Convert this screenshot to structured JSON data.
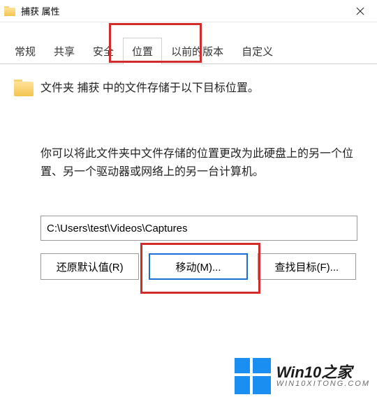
{
  "window": {
    "title": "捕获 属性"
  },
  "tabs": {
    "items": [
      {
        "label": "常规"
      },
      {
        "label": "共享"
      },
      {
        "label": "安全"
      },
      {
        "label": "位置"
      },
      {
        "label": "以前的版本"
      },
      {
        "label": "自定义"
      }
    ],
    "active_index": 3
  },
  "content": {
    "line1": "文件夹 捕获 中的文件存储于以下目标位置。",
    "line2": "你可以将此文件夹中文件存储的位置更改为此硬盘上的另一个位置、另一个驱动器或网络上的另一台计算机。",
    "path": "C:\\Users\\test\\Videos\\Captures"
  },
  "buttons": {
    "restore": "还原默认值(R)",
    "move": "移动(M)...",
    "find": "查找目标(F)..."
  },
  "watermark": {
    "brand": "Win10之家",
    "sub": "WIN10XITONG.COM"
  },
  "highlight_color": "#d22b2b",
  "accent_color": "#1a6ed8"
}
